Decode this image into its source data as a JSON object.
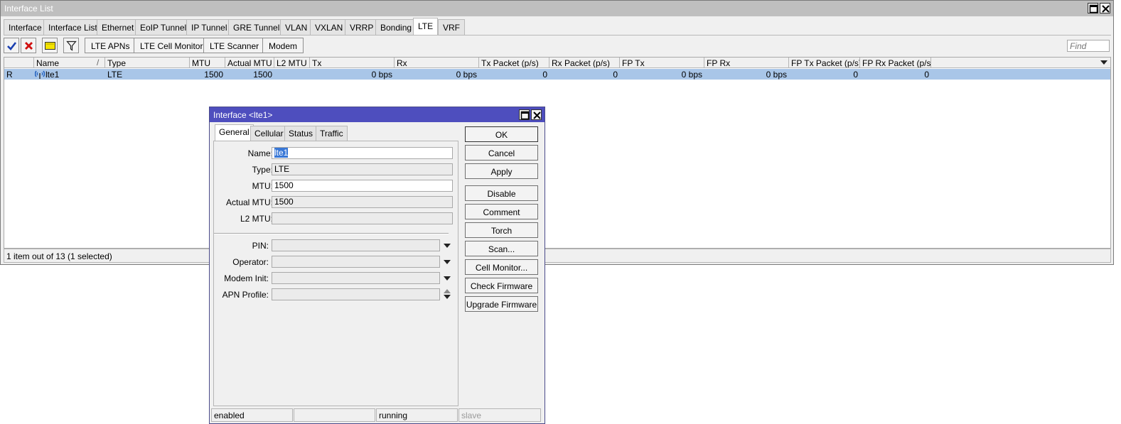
{
  "main_window": {
    "title": "Interface List",
    "tabs": [
      "Interface",
      "Interface List",
      "Ethernet",
      "EoIP Tunnel",
      "IP Tunnel",
      "GRE Tunnel",
      "VLAN",
      "VXLAN",
      "VRRP",
      "Bonding",
      "LTE",
      "VRF"
    ],
    "active_tab": "LTE",
    "toolbar": {
      "buttons": [
        "LTE APNs",
        "LTE Cell Monitor",
        "LTE Scanner",
        "Modem"
      ],
      "find_placeholder": "Find"
    },
    "table": {
      "columns": [
        "",
        "Name",
        "Type",
        "MTU",
        "Actual MTU",
        "L2 MTU",
        "Tx",
        "Rx",
        "Tx Packet (p/s)",
        "Rx Packet (p/s)",
        "FP Tx",
        "FP Rx",
        "FP Tx Packet (p/s)",
        "FP Rx Packet (p/s)"
      ],
      "sort_indicator": "/",
      "rows": [
        {
          "flag": "R",
          "name": "lte1",
          "type": "LTE",
          "mtu": "1500",
          "actual_mtu": "1500",
          "l2_mtu": "",
          "tx": "0 bps",
          "rx": "0 bps",
          "tx_packet": "0",
          "rx_packet": "0",
          "fp_tx": "0 bps",
          "fp_rx": "0 bps",
          "fp_tx_packet": "0",
          "fp_rx_packet": "0"
        }
      ]
    },
    "status": "1 item out of 13 (1 selected)"
  },
  "dialog": {
    "title": "Interface <lte1>",
    "tabs": [
      "General",
      "Cellular",
      "Status",
      "Traffic"
    ],
    "active_tab": "General",
    "fields": {
      "name_label": "Name:",
      "name_value": "lte1",
      "type_label": "Type:",
      "type_value": "LTE",
      "mtu_label": "MTU:",
      "mtu_value": "1500",
      "actual_mtu_label": "Actual MTU:",
      "actual_mtu_value": "1500",
      "l2_mtu_label": "L2 MTU:",
      "l2_mtu_value": "",
      "pin_label": "PIN:",
      "pin_value": "",
      "operator_label": "Operator:",
      "operator_value": "",
      "modem_init_label": "Modem Init:",
      "modem_init_value": "",
      "apn_profile_label": "APN Profile:",
      "apn_profile_value": ""
    },
    "buttons": [
      "OK",
      "Cancel",
      "Apply",
      "Disable",
      "Comment",
      "Torch",
      "Scan...",
      "Cell Monitor...",
      "Check Firmware",
      "Upgrade Firmware"
    ],
    "status_bar": [
      "enabled",
      "",
      "running",
      "slave"
    ]
  },
  "icons": {
    "enable": "check-icon",
    "disable": "x-icon",
    "comment": "comment-icon",
    "filter": "filter-icon",
    "lte": "lte-antenna-icon"
  },
  "colors": {
    "selected_row": "#a9c6e8",
    "dialog_title": "#4e4ebe",
    "enable_icon": "#1a3fb0",
    "disable_icon": "#d01010",
    "comment_icon": "#f5e400"
  }
}
